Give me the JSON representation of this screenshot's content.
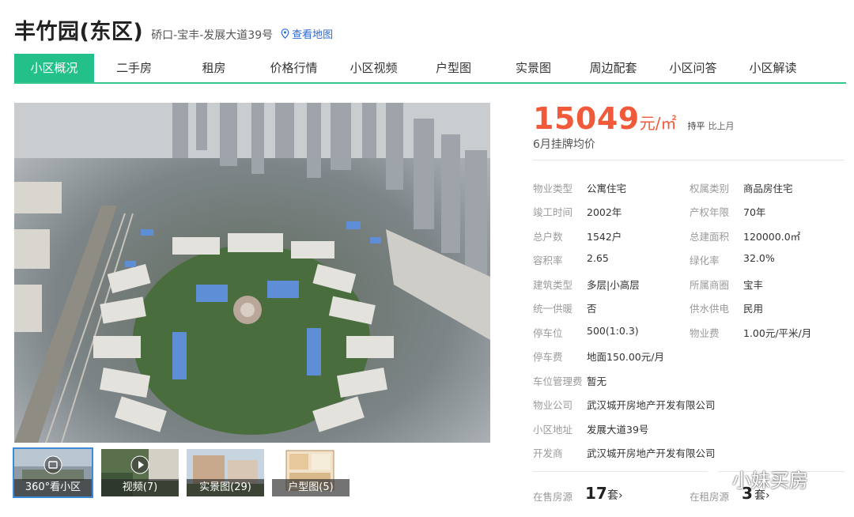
{
  "header": {
    "title": "丰竹园(东区)",
    "address": "硚口-宝丰-发展大道39号",
    "map_link": "查看地图"
  },
  "tabs": [
    {
      "label": "小区概况",
      "active": true
    },
    {
      "label": "二手房"
    },
    {
      "label": "租房"
    },
    {
      "label": "价格行情"
    },
    {
      "label": "小区视频"
    },
    {
      "label": "户型图"
    },
    {
      "label": "实景图"
    },
    {
      "label": "周边配套"
    },
    {
      "label": "小区问答"
    },
    {
      "label": "小区解读"
    }
  ],
  "thumbnails": [
    {
      "label": "360°看小区",
      "icon": "panorama-icon"
    },
    {
      "label": "视频(7)",
      "icon": "play-icon"
    },
    {
      "label": "实景图(29)"
    },
    {
      "label": "户型图(5)"
    }
  ],
  "price": {
    "value": "15049",
    "unit": "元/㎡",
    "trend": "持平",
    "trend_label": "比上月",
    "subtitle": "6月挂牌均价"
  },
  "info": {
    "rows": [
      {
        "k1": "物业类型",
        "v1": "公寓住宅",
        "k2": "权属类别",
        "v2": "商品房住宅"
      },
      {
        "k1": "竣工时间",
        "v1": "2002年",
        "k2": "产权年限",
        "v2": "70年"
      },
      {
        "k1": "总户数",
        "v1": "1542户",
        "k2": "总建面积",
        "v2": "120000.0㎡"
      },
      {
        "k1": "容积率",
        "v1": "2.65",
        "k2": "绿化率",
        "v2": "32.0%"
      },
      {
        "k1": "建筑类型",
        "v1": "多层|小高层",
        "k2": "所属商圈",
        "v2": "宝丰"
      },
      {
        "k1": "统一供暖",
        "v1": "否",
        "k2": "供水供电",
        "v2": "民用"
      },
      {
        "k1": "停车位",
        "v1": "500(1:0.3)",
        "k2": "物业费",
        "v2": "1.00元/平米/月"
      }
    ],
    "single_rows": [
      {
        "k": "停车费",
        "v": "地面150.00元/月"
      },
      {
        "k": "车位管理费",
        "v": "暂无"
      },
      {
        "k": "物业公司",
        "v": "武汉城开房地产开发有限公司"
      },
      {
        "k": "小区地址",
        "v": "发展大道39号"
      },
      {
        "k": "开发商",
        "v": "武汉城开房地产开发有限公司"
      }
    ]
  },
  "stats": {
    "sale_label": "在售房源",
    "sale_count": "17",
    "sale_unit": "套›",
    "rent_label": "在租房源",
    "rent_count": "3",
    "rent_unit": "套›"
  },
  "watermark": "小妹买房",
  "colors": {
    "accent": "#24c08a",
    "price": "#f05a3a",
    "link": "#2a6ad9"
  }
}
